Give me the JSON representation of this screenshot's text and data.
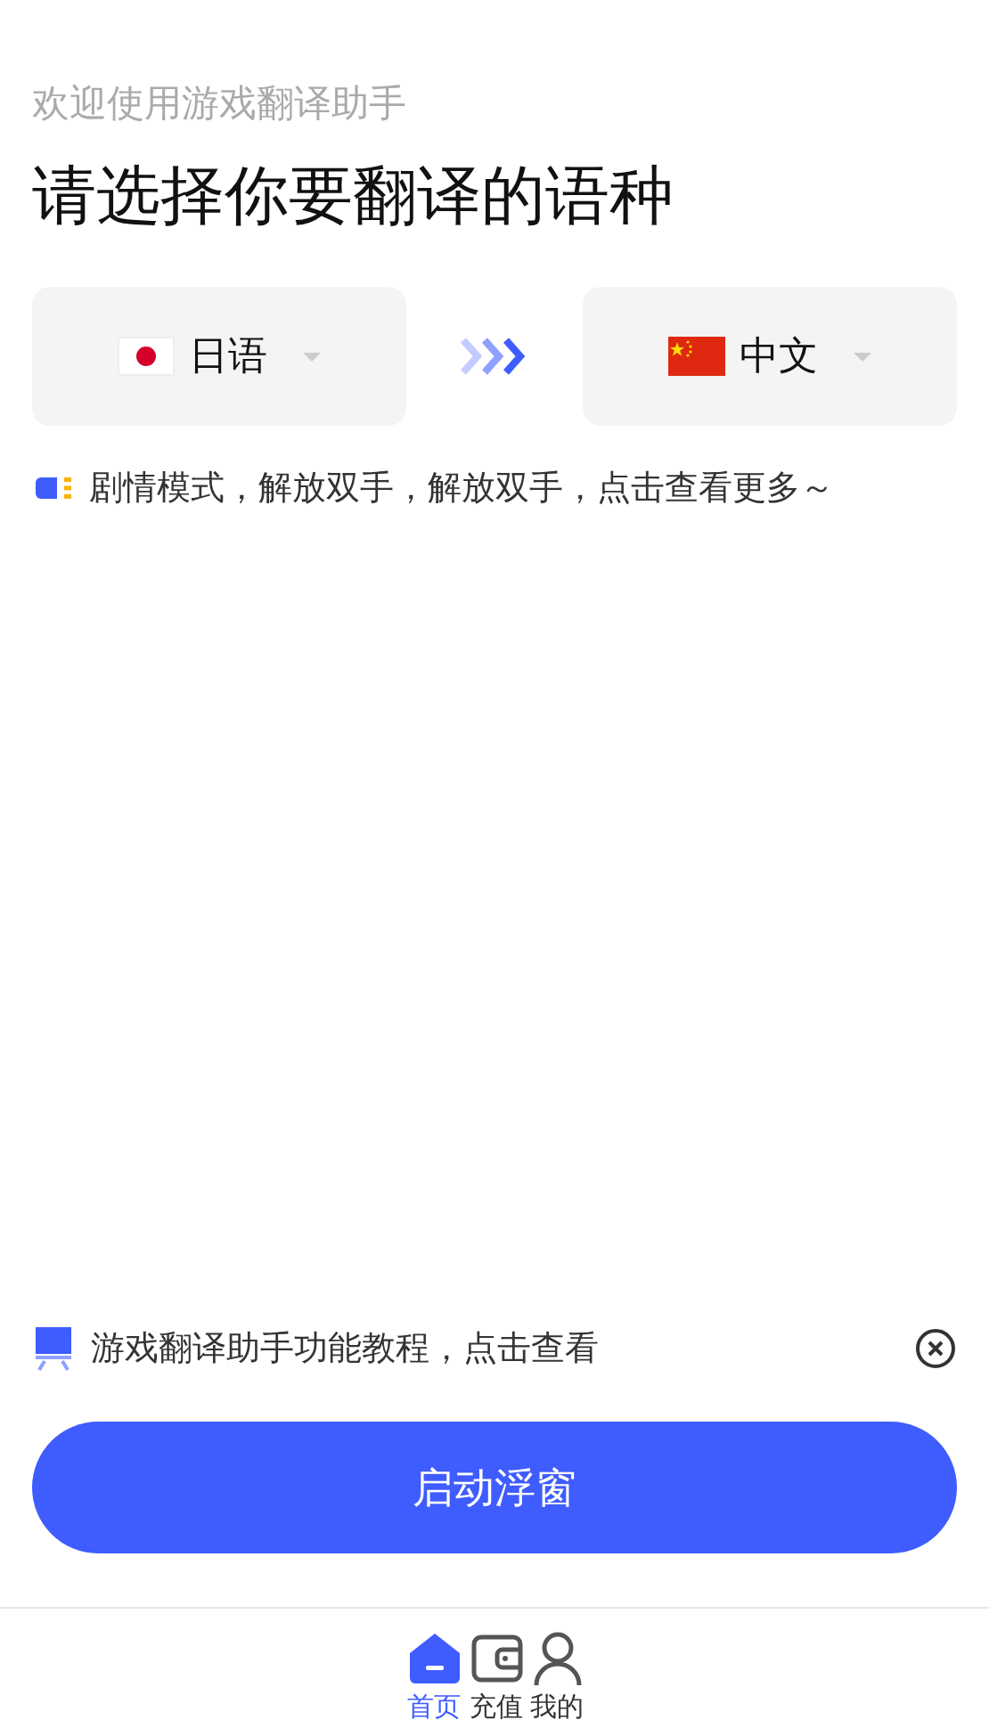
{
  "header": {
    "subtitle": "欢迎使用游戏翻译助手",
    "title": "请选择你要翻译的语种"
  },
  "languages": [
    {
      "label": "日语"
    },
    {
      "label": "中文"
    }
  ],
  "notice": "剧情模式，解放双手，解放双手，点击查看更多～",
  "tutorial": "游戏翻译助手功能教程，点击查看",
  "start_button": "启动浮窗",
  "nav": [
    {
      "label": "首页",
      "selected": true
    },
    {
      "label": "充值",
      "selected": false
    },
    {
      "label": "我的",
      "selected": false
    }
  ]
}
